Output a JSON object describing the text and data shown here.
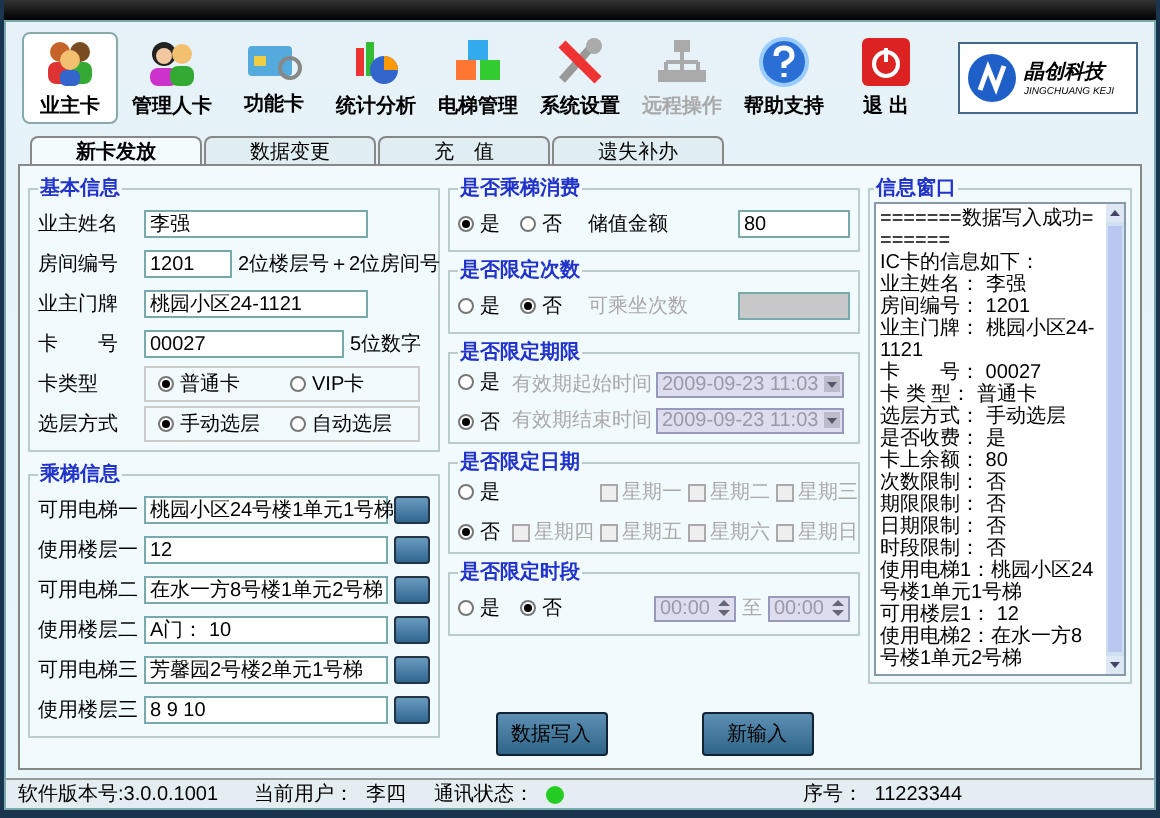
{
  "toolbar": [
    {
      "label": "业主卡",
      "selected": true,
      "disabled": false
    },
    {
      "label": "管理人卡",
      "selected": false,
      "disabled": false
    },
    {
      "label": "功能卡",
      "selected": false,
      "disabled": false
    },
    {
      "label": "统计分析",
      "selected": false,
      "disabled": false
    },
    {
      "label": "电梯管理",
      "selected": false,
      "disabled": false
    },
    {
      "label": "系统设置",
      "selected": false,
      "disabled": false
    },
    {
      "label": "远程操作",
      "selected": false,
      "disabled": true
    },
    {
      "label": "帮助支持",
      "selected": false,
      "disabled": false
    },
    {
      "label": "退 出",
      "selected": false,
      "disabled": false
    }
  ],
  "logo": {
    "name": "晶创科技",
    "subtitle": "JINGCHUANG KEJI"
  },
  "tabs": [
    {
      "label": "新卡发放",
      "selected": true
    },
    {
      "label": "数据变更",
      "selected": false
    },
    {
      "label": "充　值",
      "selected": false
    },
    {
      "label": "遗失补办",
      "selected": false
    }
  ],
  "basic_info": {
    "title": "基本信息",
    "fields": [
      {
        "kind": "input",
        "label": "业主姓名",
        "value": "李强"
      },
      {
        "kind": "short_input",
        "label": "房间编号",
        "value": "1201",
        "hint": "2位楼层号＋2位房间号"
      },
      {
        "kind": "input",
        "label": "业主门牌",
        "value": "桃园小区24-1121"
      },
      {
        "kind": "input",
        "label": "卡　　号",
        "value": "00027",
        "hint": "5位数字"
      },
      {
        "kind": "radio",
        "label": "卡类型",
        "options": [
          {
            "label": "普通卡",
            "selected": true
          },
          {
            "label": "VIP卡",
            "selected": false
          }
        ]
      },
      {
        "kind": "radio",
        "label": "选层方式",
        "options": [
          {
            "label": "手动选层",
            "selected": true
          },
          {
            "label": "自动选层",
            "selected": false
          }
        ]
      }
    ]
  },
  "elevator_info": {
    "title": "乘梯信息",
    "rows": [
      {
        "label": "可用电梯一",
        "value": "桃园小区24号楼1单元1号梯"
      },
      {
        "label": "使用楼层一",
        "value": "12"
      },
      {
        "label": "可用电梯二",
        "value": "在水一方8号楼1单元2号梯"
      },
      {
        "label": "使用楼层二",
        "value": "A门：  10"
      },
      {
        "label": "可用电梯三",
        "value": "芳馨园2号楼2单元1号梯"
      },
      {
        "label": "使用楼层三",
        "value": "8 9 10"
      }
    ]
  },
  "limits": [
    {
      "kind": "amount",
      "title": "是否乘梯消费",
      "options": [
        {
          "label": "是",
          "selected": true
        },
        {
          "label": "否",
          "selected": false
        }
      ],
      "field_label": "储值金额",
      "value": "80",
      "disabled": false
    },
    {
      "kind": "count",
      "title": "是否限定次数",
      "options": [
        {
          "label": "是",
          "selected": false
        },
        {
          "label": "否",
          "selected": true
        }
      ],
      "field_label": "可乘坐次数",
      "disabled": true
    },
    {
      "kind": "period",
      "title": "是否限定期限",
      "options": [
        {
          "label": "是",
          "selected": false
        },
        {
          "label": "否",
          "selected": true
        }
      ],
      "disabled": true,
      "rows": [
        {
          "label": "有效期起始时间",
          "value": "2009-09-23 11:03"
        },
        {
          "label": "有效期结束时间",
          "value": "2009-09-23 11:03"
        }
      ]
    },
    {
      "kind": "days",
      "title": "是否限定日期",
      "options": [
        {
          "label": "是",
          "selected": false
        },
        {
          "label": "否",
          "selected": true
        }
      ],
      "disabled": true,
      "days": [
        {
          "label": "星期一",
          "checked": false
        },
        {
          "label": "星期二",
          "checked": false
        },
        {
          "label": "星期三",
          "checked": false
        },
        {
          "label": "星期四",
          "checked": false
        },
        {
          "label": "星期五",
          "checked": false
        },
        {
          "label": "星期六",
          "checked": false
        },
        {
          "label": "星期日",
          "checked": false
        }
      ]
    },
    {
      "kind": "time",
      "title": "是否限定时段",
      "options": [
        {
          "label": "是",
          "selected": false
        },
        {
          "label": "否",
          "selected": true
        }
      ],
      "disabled": true,
      "from": "00:00",
      "to_label": "至",
      "to": "00:00"
    }
  ],
  "info_window": {
    "title": "信息窗口",
    "lines": [
      "=======数据写入成功=======",
      "IC卡的信息如下：",
      "业主姓名：  李强",
      "房间编号：  1201",
      "业主门牌：  桃园小区24-1121",
      "卡　　号：  00027",
      "卡 类 型：  普通卡",
      "选层方式：  手动选层",
      "是否收费：  是",
      "卡上余额：  80",
      "次数限制：  否",
      "期限限制：  否",
      "日期限制：  否",
      "时段限制：  否",
      "使用电梯1：桃园小区24号楼1单元1号梯",
      "可用楼层1：  12",
      "使用电梯2：在水一方8号楼1单元2号梯"
    ]
  },
  "buttons": [
    "数据写入",
    "新输入"
  ],
  "status_bar": {
    "version": "软件版本号:3.0.0.1001",
    "user_label": "当前用户：",
    "user": "李四",
    "comm_label": "通讯状态：",
    "connected": true,
    "serial_label": "序号：",
    "serial": "11223344"
  }
}
